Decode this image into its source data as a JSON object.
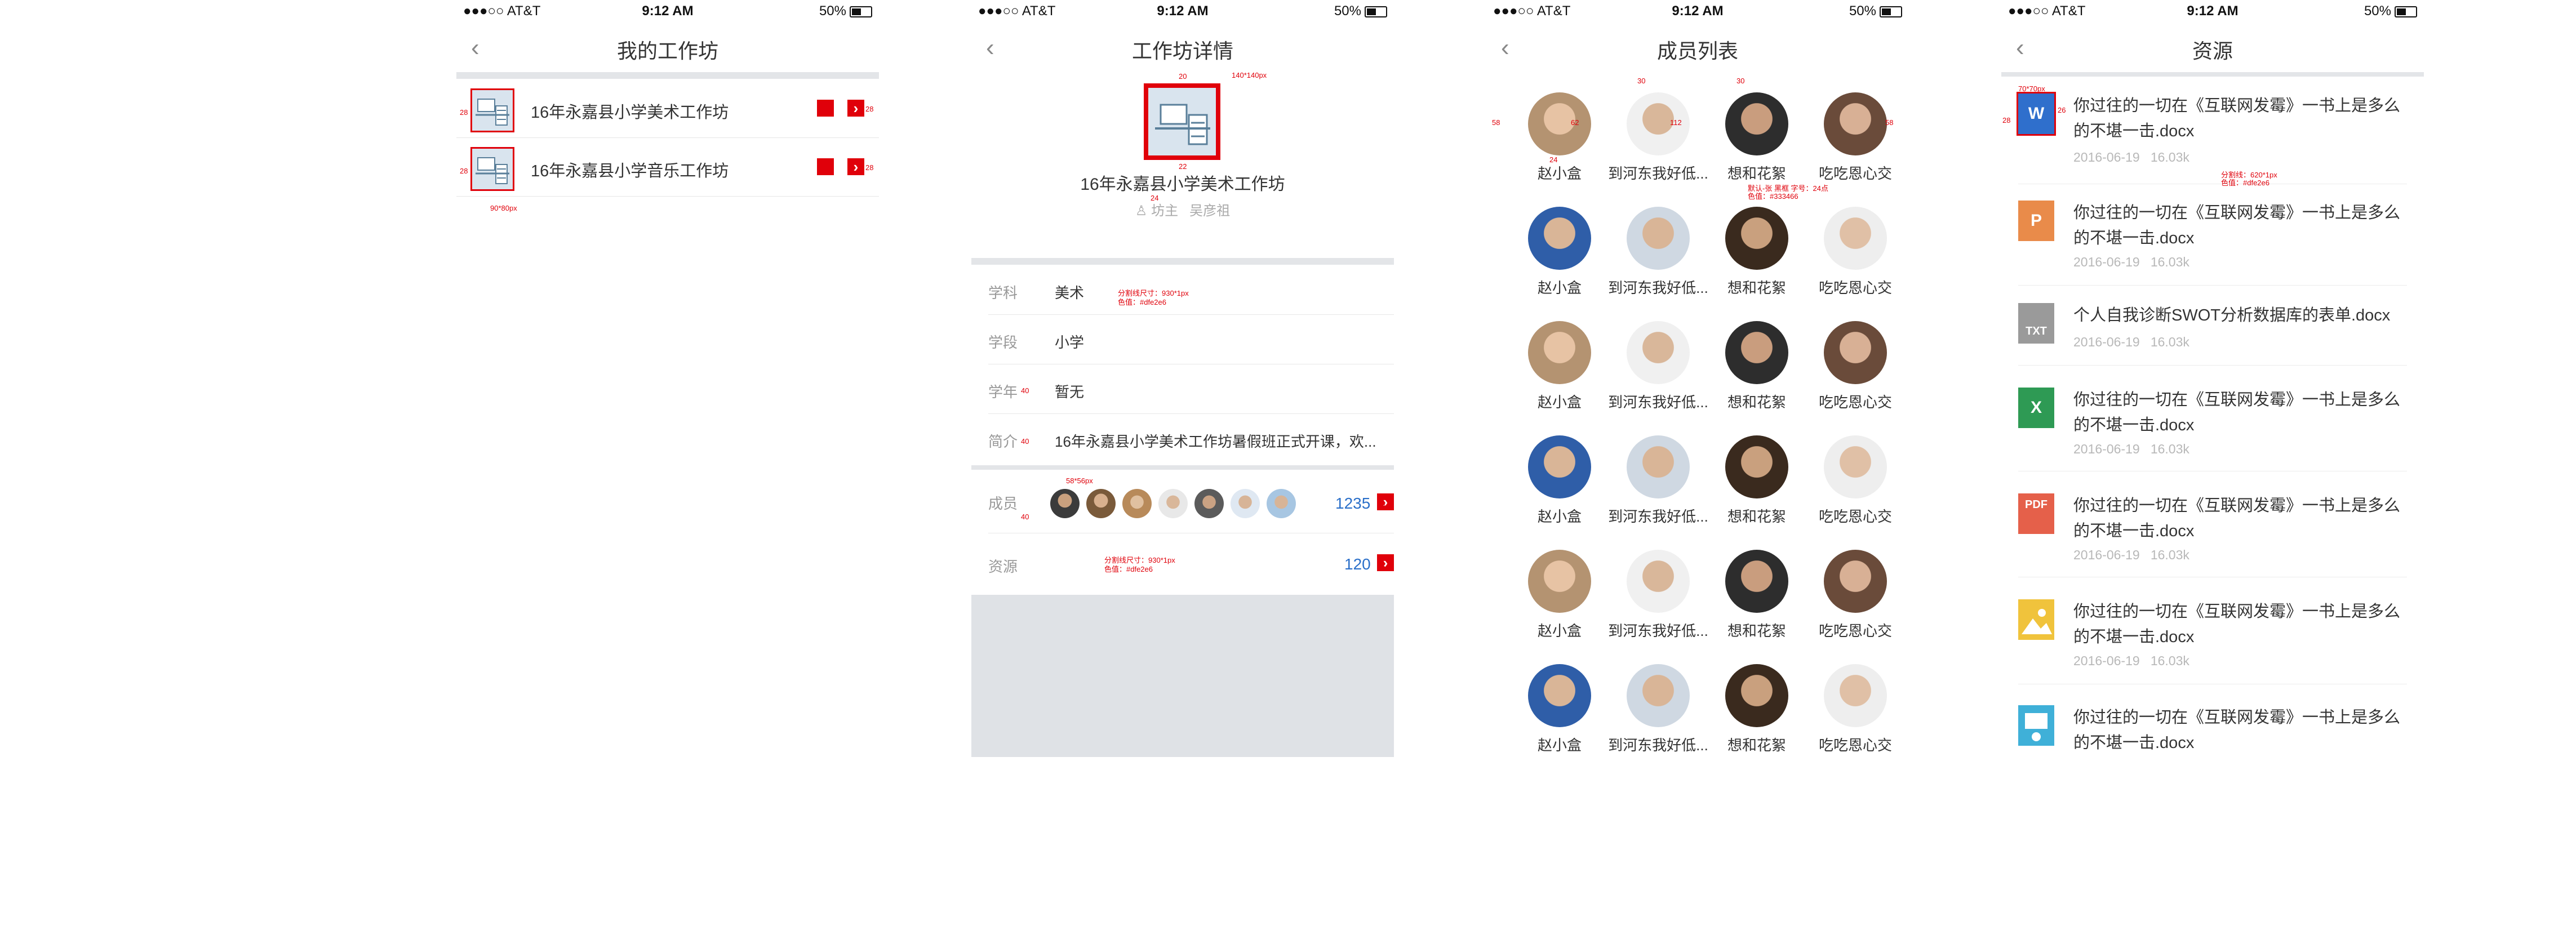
{
  "status_bar": {
    "carrier": "●●●○○ AT&T",
    "time": "9:12 AM",
    "battery": "50%"
  },
  "screen1": {
    "title": "我的工作坊",
    "items": [
      {
        "name": "16年永嘉县小学美术工作坊"
      },
      {
        "name": "16年永嘉县小学音乐工作坊"
      }
    ],
    "annotations": {
      "left_margin": "28",
      "right_margin": "28",
      "icon_size": "90*80px"
    }
  },
  "screen2": {
    "title": "工作坊详情",
    "workshop_name": "16年永嘉县小学美术工作坊",
    "owner_label": "坊主",
    "owner_name": "吴彦祖",
    "rows": [
      {
        "label": "学科",
        "value": "美术"
      },
      {
        "label": "学段",
        "value": "小学"
      },
      {
        "label": "学年",
        "value": "暂无"
      },
      {
        "label": "简介",
        "value": "16年永嘉县小学美术工作坊暑假班正式开课，欢..."
      }
    ],
    "members_label": "成员",
    "members_count": "1235",
    "resources_label": "资源",
    "resources_count": "120",
    "annotations": {
      "icon_size": "140*140px",
      "top_gap": "20",
      "name_gap": "22",
      "owner_gap": "24",
      "divider_1": "分割线尺寸：930*1px",
      "divider_1_color": "色值：#dfe2e6",
      "label_gap_1": "40",
      "label_gap_2": "40",
      "avatar_size": "58*56px",
      "member_gap": "40",
      "member_right": "22",
      "resource_right": "22",
      "divider_2": "分割线尺寸：930*1px",
      "divider_2_color": "色值：#dfe2e6"
    }
  },
  "screen3": {
    "title": "成员列表",
    "names": [
      "赵小盒",
      "到河东我好低...",
      "想和花絮",
      "吃吃恩心交"
    ],
    "annotations": {
      "left": "58",
      "gap": "62",
      "right": "58",
      "height": "112",
      "top1": "30",
      "top2": "30",
      "name_gap": "24",
      "font_note": "默认-张 黑框 字号：24点",
      "font_color": "色值：#333466"
    }
  },
  "screen4": {
    "title": "资源",
    "items": [
      {
        "icon": "word-icon",
        "name": "你过往的一切在《互联网发霉》一书上是多么的不堪一击.docx",
        "date": "2016-06-19",
        "size": "16.03k",
        "color": "#2f6fcc"
      },
      {
        "icon": "ppt-icon",
        "name": "你过往的一切在《互联网发霉》一书上是多么的不堪一击.docx",
        "date": "2016-06-19",
        "size": "16.03k",
        "color": "#e98b4a"
      },
      {
        "icon": "txt-icon",
        "name": "个人自我诊断SWOT分析数据库的表单.docx",
        "date": "2016-06-19",
        "size": "16.03k",
        "color": "#9a9a9a"
      },
      {
        "icon": "excel-icon",
        "name": "你过往的一切在《互联网发霉》一书上是多么的不堪一击.docx",
        "date": "2016-06-19",
        "size": "16.03k",
        "color": "#2e9a54"
      },
      {
        "icon": "pdf-icon",
        "name": "你过往的一切在《互联网发霉》一书上是多么的不堪一击.docx",
        "date": "2016-06-19",
        "size": "16.03k",
        "color": "#e5604a"
      },
      {
        "icon": "image-icon",
        "name": "你过往的一切在《互联网发霉》一书上是多么的不堪一击.docx",
        "date": "2016-06-19",
        "size": "16.03k",
        "color": "#f0c33c"
      },
      {
        "icon": "media-icon",
        "name": "你过往的一切在《互联网发霉》一书上是多么的不堪一击.docx",
        "date": "",
        "size": "",
        "color": "#3fb0d8"
      }
    ],
    "icon_labels": {
      "word": "W",
      "ppt": "P",
      "txt": "TXT",
      "pdf": "PDF"
    },
    "annotations": {
      "icon_size": "70*70px",
      "left": "28",
      "top": "26",
      "divider": "分割线：620*1px",
      "divider_color": "色值：#dfe2e6"
    }
  }
}
